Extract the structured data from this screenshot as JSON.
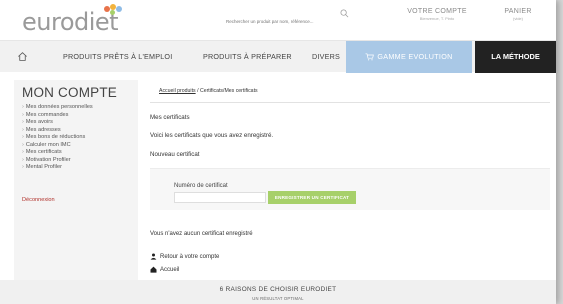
{
  "header": {
    "logo_text": "eurodiet",
    "logo_dot_colors": [
      "#e8734a",
      "#f2b33d",
      "#8fbce6",
      "#a7d06a"
    ],
    "search_placeholder": "Rechercher un produit par nom, référence...",
    "search_icon": "search-icon",
    "account_title": "VOTRE COMPTE",
    "account_sub": "Bienvenue, T. Pinto",
    "cart_title": "PANIER",
    "cart_sub": "(vide)"
  },
  "nav": {
    "home_icon": "home-icon",
    "items": [
      "PRODUITS PRÊTS À L'EMPLOI",
      "PRODUITS À PRÉPARER",
      "DIVERS"
    ],
    "evolution_label": "GAMME EVOLUTION",
    "methode_label": "LA MÉTHODE",
    "evolution_color": "#a9c8e6",
    "methode_color": "#222222"
  },
  "sidebar": {
    "title": "MON COMPTE",
    "items": [
      "Mes données personnelles",
      "Mes commandes",
      "Mes avoirs",
      "Mes adresses",
      "Mes bons de réductions",
      "Calculer mon IMC",
      "Mes certificats",
      "Motivation Profiler",
      "Mental Profiler"
    ],
    "logout_label": "Déconnexion",
    "logout_color": "#b0302a"
  },
  "main": {
    "breadcrumb_link": "Accueil produits",
    "breadcrumb_rest": " / Certificats/Mes certificats",
    "heading": "Mes certificats",
    "intro": "Voici les certificats que vous avez enregistré.",
    "new_cert": "Nouveau certificat",
    "form_label": "Numéro de certificat",
    "form_input_value": "",
    "form_button": "ENREGISTRER UN CERTIFICAT",
    "form_button_color": "#a7d06a",
    "no_cert": "Vous n'avez aucun certificat enregistré",
    "back_link": "Retour à votre compte",
    "home_link": "Accueil"
  },
  "footer": {
    "title": "6 RAISONS DE CHOISIR EURODIET",
    "subtitle": "UN RÉSULTAT OPTIMAL"
  }
}
